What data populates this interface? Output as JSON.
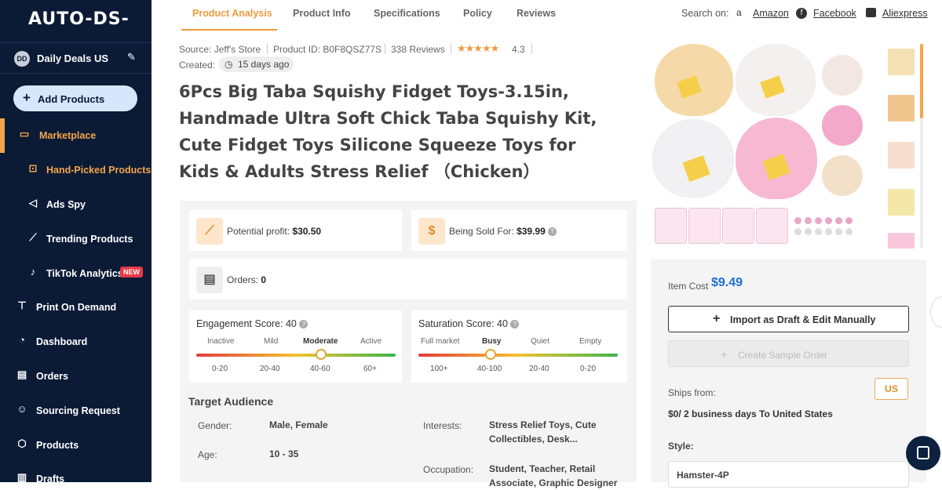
{
  "sidebar": {
    "logo": "AUTO-DS-",
    "store_initials": "DD",
    "store_name": "Daily Deals US",
    "add_products": "Add Products",
    "items": [
      {
        "label": "Marketplace",
        "icon": "store-icon"
      },
      {
        "label": "Hand-Picked Products",
        "icon": "hand-picked-icon"
      },
      {
        "label": "Ads Spy",
        "icon": "megaphone-icon"
      },
      {
        "label": "Trending Products",
        "icon": "trending-icon"
      },
      {
        "label": "TikTok Analytics",
        "icon": "tiktok-icon"
      },
      {
        "label": "Print On Demand",
        "icon": "shirt-icon"
      },
      {
        "label": "Dashboard",
        "icon": "gauge-icon"
      },
      {
        "label": "Orders",
        "icon": "document-icon"
      },
      {
        "label": "Sourcing Request",
        "icon": "people-icon"
      },
      {
        "label": "Products",
        "icon": "box-icon"
      },
      {
        "label": "Drafts",
        "icon": "drafts-icon"
      }
    ],
    "new_badge": "NEW",
    "accent": "#f4a44a"
  },
  "tabs": [
    "Product Analysis",
    "Product Info",
    "Specifications",
    "Policy",
    "Reviews"
  ],
  "search_on": {
    "label": "Search on:",
    "links": [
      "Amazon",
      "Facebook",
      "Aliexpress"
    ]
  },
  "product": {
    "source": "Source: Jeff's Store",
    "product_id": "Product ID: B0F8QSZ77S",
    "reviews": "338 Reviews",
    "rating": "4.3",
    "created_label": "Created:",
    "created_value": "15 days ago",
    "title": "6Pcs Big Taba Squishy Fidget Toys-3.15in, Handmade Ultra Soft Chick Taba Squishy Kit, Cute Fidget Toys Silicone Squeeze Toys for Kids & Adults Stress Relief （Chicken）"
  },
  "stats": {
    "potential_profit_label": "Potential profit:",
    "potential_profit_value": "$30.50",
    "being_sold_label": "Being Sold For:",
    "being_sold_value": "$39.99",
    "orders_label": "Orders:",
    "orders_value": "0"
  },
  "engagement": {
    "title": "Engagement Score: 40",
    "labels": [
      "Inactive",
      "Mild",
      "Moderate",
      "Active"
    ],
    "ranges": [
      "0-20",
      "20-40",
      "40-60",
      "60+"
    ],
    "selected": "Moderate"
  },
  "saturation": {
    "title": "Saturation Score: 40",
    "labels": [
      "Full market",
      "Busy",
      "Quiet",
      "Empty"
    ],
    "ranges": [
      "100+",
      "40-100",
      "20-40",
      "0-20"
    ],
    "selected": "Busy"
  },
  "audience": {
    "title": "Target Audience",
    "gender_label": "Gender:",
    "gender_value": "Male, Female",
    "age_label": "Age:",
    "age_value": "10 - 35",
    "interests_label": "Interests:",
    "interests_value": "Stress Relief Toys, Cute Collectibles, Desk...",
    "occupation_label": "Occupation:",
    "occupation_value": "Student, Teacher, Retail Associate, Graphic Designer"
  },
  "purchase": {
    "item_cost_label": "Item Cost",
    "item_cost_value": "$9.49",
    "import_button": "Import as Draft & Edit Manually",
    "sample_button": "Create Sample Order",
    "ships_from_label": "Ships from:",
    "ships_from_country": "US",
    "shipping_cost": "$0/ 2 business days",
    "shipping_dest": "To United States",
    "style_label": "Style:",
    "style_value": "Hamster-4P",
    "price_color": "#1f6fd6"
  }
}
